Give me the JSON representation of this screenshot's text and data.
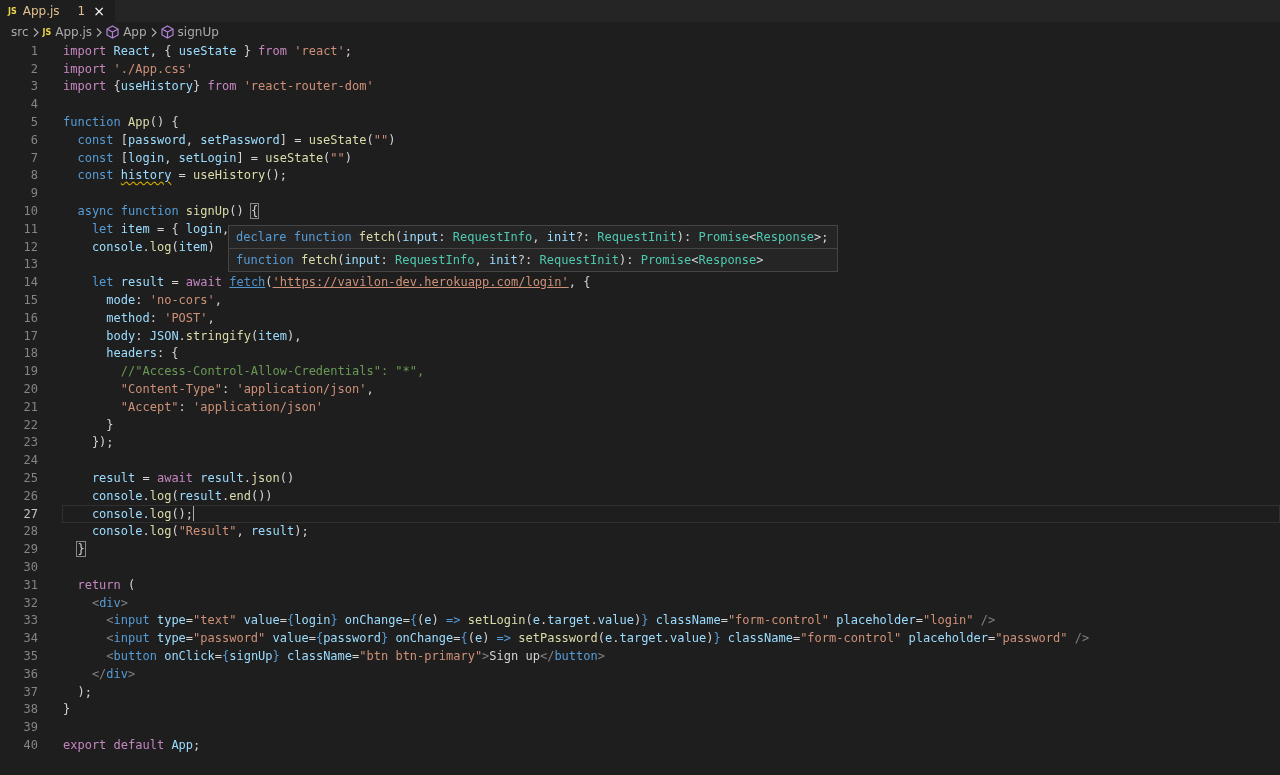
{
  "tab": {
    "file_type": "JS",
    "label": "App.js",
    "problems": "1",
    "close": "×",
    "selected": true
  },
  "breadcrumb": [
    {
      "kind": "folder",
      "label": "src"
    },
    {
      "kind": "file",
      "file_type": "JS",
      "label": "App.js"
    },
    {
      "kind": "symbol",
      "label": "App"
    },
    {
      "kind": "symbol",
      "label": "signUp"
    }
  ],
  "lines": [
    {
      "number": "1",
      "active": false,
      "tokens": [
        {
          "kind": "kw",
          "text": "import"
        },
        {
          "kind": "var",
          "text": " React"
        },
        {
          "kind": "plain",
          "text": ", { "
        },
        {
          "kind": "var",
          "text": "useState"
        },
        {
          "kind": "plain",
          "text": " } "
        },
        {
          "kind": "kw",
          "text": "from"
        },
        {
          "kind": "str",
          "text": " 'react'"
        },
        {
          "kind": "plain",
          "text": ";"
        }
      ]
    },
    {
      "number": "2",
      "active": false,
      "tokens": [
        {
          "kind": "kw",
          "text": "import"
        },
        {
          "kind": "str",
          "text": " './App.css'"
        }
      ]
    },
    {
      "number": "3",
      "active": false,
      "tokens": [
        {
          "kind": "kw",
          "text": "import"
        },
        {
          "kind": "plain",
          "text": " {"
        },
        {
          "kind": "var",
          "text": "useHistory"
        },
        {
          "kind": "plain",
          "text": "} "
        },
        {
          "kind": "kw",
          "text": "from"
        },
        {
          "kind": "str",
          "text": " 'react-router-dom'"
        }
      ]
    },
    {
      "number": "4",
      "active": false
    },
    {
      "number": "5",
      "active": false,
      "tokens": [
        {
          "kind": "decl",
          "text": "function"
        },
        {
          "kind": "fn",
          "text": " App"
        },
        {
          "kind": "plain",
          "text": "() {"
        }
      ]
    },
    {
      "number": "6",
      "active": false,
      "tokens": [
        {
          "kind": "decl",
          "text": "  const"
        },
        {
          "kind": "plain",
          "text": " ["
        },
        {
          "kind": "var",
          "text": "password"
        },
        {
          "kind": "plain",
          "text": ", "
        },
        {
          "kind": "var",
          "text": "setPassword"
        },
        {
          "kind": "plain",
          "text": "] = "
        },
        {
          "kind": "fn",
          "text": "useState"
        },
        {
          "kind": "plain",
          "text": "("
        },
        {
          "kind": "str",
          "text": "\"\""
        },
        {
          "kind": "plain",
          "text": ")"
        }
      ]
    },
    {
      "number": "7",
      "active": false,
      "tokens": [
        {
          "kind": "decl",
          "text": "  const"
        },
        {
          "kind": "plain",
          "text": " ["
        },
        {
          "kind": "var",
          "text": "login"
        },
        {
          "kind": "plain",
          "text": ", "
        },
        {
          "kind": "var",
          "text": "setLogin"
        },
        {
          "kind": "plain",
          "text": "] = "
        },
        {
          "kind": "fn",
          "text": "useState"
        },
        {
          "kind": "plain",
          "text": "("
        },
        {
          "kind": "str",
          "text": "\"\""
        },
        {
          "kind": "plain",
          "text": ")"
        }
      ]
    },
    {
      "number": "8",
      "active": false,
      "tokens": [
        {
          "kind": "decl",
          "text": "  const "
        },
        {
          "kind": "warn",
          "text": "history"
        },
        {
          "kind": "plain",
          "text": " = "
        },
        {
          "kind": "fn",
          "text": "useHistory"
        },
        {
          "kind": "plain",
          "text": "();"
        }
      ]
    },
    {
      "number": "9",
      "active": false
    },
    {
      "number": "10",
      "active": false,
      "tokens": [
        {
          "kind": "decl",
          "text": "  async"
        },
        {
          "kind": "decl",
          "text": " function"
        },
        {
          "kind": "fn",
          "text": " signUp"
        },
        {
          "kind": "plain",
          "text": "() "
        },
        {
          "kind": "match",
          "text": "{"
        }
      ]
    },
    {
      "number": "11",
      "active": false,
      "tokens": [
        {
          "kind": "decl",
          "text": "    let"
        },
        {
          "kind": "var",
          "text": " item"
        },
        {
          "kind": "plain",
          "text": " = { "
        },
        {
          "kind": "var",
          "text": "login"
        },
        {
          "kind": "plain",
          "text": ","
        }
      ]
    },
    {
      "number": "12",
      "active": false,
      "tokens": [
        {
          "kind": "var",
          "text": "    console"
        },
        {
          "kind": "plain",
          "text": "."
        },
        {
          "kind": "fn",
          "text": "log"
        },
        {
          "kind": "plain",
          "text": "("
        },
        {
          "kind": "var",
          "text": "item"
        },
        {
          "kind": "plain",
          "text": ")"
        }
      ]
    },
    {
      "number": "13",
      "active": false
    },
    {
      "number": "14",
      "active": false,
      "tokens": [
        {
          "kind": "decl",
          "text": "    let"
        },
        {
          "kind": "var",
          "text": " result"
        },
        {
          "kind": "plain",
          "text": " = "
        },
        {
          "kind": "kw",
          "text": "await "
        },
        {
          "kind": "hover",
          "text": "fetch"
        },
        {
          "kind": "plain",
          "text": "("
        },
        {
          "kind": "url",
          "text": "'https://vavilon-dev.herokuapp.com/login'"
        },
        {
          "kind": "plain",
          "text": ", {"
        }
      ]
    },
    {
      "number": "15",
      "active": false,
      "tokens": [
        {
          "kind": "var",
          "text": "      mode"
        },
        {
          "kind": "plain",
          "text": ": "
        },
        {
          "kind": "str",
          "text": "'no-cors'"
        },
        {
          "kind": "plain",
          "text": ","
        }
      ]
    },
    {
      "number": "16",
      "active": false,
      "tokens": [
        {
          "kind": "var",
          "text": "      method"
        },
        {
          "kind": "plain",
          "text": ": "
        },
        {
          "kind": "str",
          "text": "'POST'"
        },
        {
          "kind": "plain",
          "text": ","
        }
      ]
    },
    {
      "number": "17",
      "active": false,
      "tokens": [
        {
          "kind": "var",
          "text": "      body"
        },
        {
          "kind": "plain",
          "text": ": "
        },
        {
          "kind": "var",
          "text": "JSON"
        },
        {
          "kind": "plain",
          "text": "."
        },
        {
          "kind": "fn",
          "text": "stringify"
        },
        {
          "kind": "plain",
          "text": "("
        },
        {
          "kind": "var",
          "text": "item"
        },
        {
          "kind": "plain",
          "text": "),"
        }
      ]
    },
    {
      "number": "18",
      "active": false,
      "tokens": [
        {
          "kind": "var",
          "text": "      headers"
        },
        {
          "kind": "plain",
          "text": ": {"
        }
      ]
    },
    {
      "number": "19",
      "active": false,
      "tokens": [
        {
          "kind": "comment",
          "text": "        //\"Access-Control-Allow-Credentials\": \"*\","
        }
      ]
    },
    {
      "number": "20",
      "active": false,
      "tokens": [
        {
          "kind": "str",
          "text": "        \"Content-Type\""
        },
        {
          "kind": "plain",
          "text": ": "
        },
        {
          "kind": "str",
          "text": "'application/json'"
        },
        {
          "kind": "plain",
          "text": ","
        }
      ]
    },
    {
      "number": "21",
      "active": false,
      "tokens": [
        {
          "kind": "str",
          "text": "        \"Accept\""
        },
        {
          "kind": "plain",
          "text": ": "
        },
        {
          "kind": "str",
          "text": "'application/json'"
        }
      ]
    },
    {
      "number": "22",
      "active": false,
      "tokens": [
        {
          "kind": "plain",
          "text": "      }"
        }
      ]
    },
    {
      "number": "23",
      "active": false,
      "tokens": [
        {
          "kind": "plain",
          "text": "    });"
        }
      ]
    },
    {
      "number": "24",
      "active": false
    },
    {
      "number": "25",
      "active": false,
      "tokens": [
        {
          "kind": "var",
          "text": "    result"
        },
        {
          "kind": "plain",
          "text": " = "
        },
        {
          "kind": "kw",
          "text": "await"
        },
        {
          "kind": "var",
          "text": " result"
        },
        {
          "kind": "plain",
          "text": "."
        },
        {
          "kind": "fn",
          "text": "json"
        },
        {
          "kind": "plain",
          "text": "()"
        }
      ]
    },
    {
      "number": "26",
      "active": false,
      "tokens": [
        {
          "kind": "var",
          "text": "    console"
        },
        {
          "kind": "plain",
          "text": "."
        },
        {
          "kind": "fn",
          "text": "log"
        },
        {
          "kind": "plain",
          "text": "("
        },
        {
          "kind": "var",
          "text": "result"
        },
        {
          "kind": "plain",
          "text": "."
        },
        {
          "kind": "fn",
          "text": "end"
        },
        {
          "kind": "plain",
          "text": "())"
        }
      ]
    },
    {
      "number": "27",
      "active": true,
      "tokens": [
        {
          "kind": "var",
          "text": "    console."
        },
        {
          "kind": "fn",
          "text": "log"
        },
        {
          "kind": "plain",
          "text": "();"
        }
      ]
    },
    {
      "number": "28",
      "active": false,
      "tokens": [
        {
          "kind": "var",
          "text": "    console"
        },
        {
          "kind": "plain",
          "text": "."
        },
        {
          "kind": "fn",
          "text": "log"
        },
        {
          "kind": "plain",
          "text": "("
        },
        {
          "kind": "str",
          "text": "\"Result\""
        },
        {
          "kind": "plain",
          "text": ", "
        },
        {
          "kind": "var",
          "text": "result"
        },
        {
          "kind": "plain",
          "text": ");"
        }
      ]
    },
    {
      "number": "29",
      "active": false,
      "tokens": [
        {
          "kind": "indented_match",
          "text": "}"
        }
      ]
    },
    {
      "number": "30",
      "active": false
    },
    {
      "number": "31",
      "active": false,
      "tokens": [
        {
          "kind": "kw",
          "text": "  return"
        },
        {
          "kind": "plain",
          "text": " ("
        }
      ]
    },
    {
      "number": "32",
      "active": false,
      "tokens": [
        {
          "kind": "tag",
          "text": "    <"
        },
        {
          "kind": "decl",
          "text": "div"
        },
        {
          "kind": "tag",
          "text": ">"
        }
      ]
    },
    {
      "number": "33",
      "active": false,
      "tokens": [
        {
          "kind": "tag",
          "text": "      <"
        },
        {
          "kind": "decl",
          "text": "input"
        },
        {
          "kind": "var",
          "text": " type"
        },
        {
          "kind": "plain",
          "text": "="
        },
        {
          "kind": "str",
          "text": "\"text\""
        },
        {
          "kind": "var",
          "text": " value"
        },
        {
          "kind": "plain",
          "text": "="
        },
        {
          "kind": "decl",
          "text": "{"
        },
        {
          "kind": "var",
          "text": "login"
        },
        {
          "kind": "decl",
          "text": "}"
        },
        {
          "kind": "var",
          "text": " onChange"
        },
        {
          "kind": "plain",
          "text": "="
        },
        {
          "kind": "decl",
          "text": "{"
        },
        {
          "kind": "plain",
          "text": "("
        },
        {
          "kind": "var",
          "text": "e"
        },
        {
          "kind": "plain",
          "text": ") "
        },
        {
          "kind": "decl",
          "text": "=>"
        },
        {
          "kind": "fn",
          "text": " setLogin"
        },
        {
          "kind": "plain",
          "text": "("
        },
        {
          "kind": "var",
          "text": "e"
        },
        {
          "kind": "plain",
          "text": "."
        },
        {
          "kind": "var",
          "text": "target"
        },
        {
          "kind": "plain",
          "text": "."
        },
        {
          "kind": "var",
          "text": "value"
        },
        {
          "kind": "plain",
          "text": ")"
        },
        {
          "kind": "decl",
          "text": "}"
        },
        {
          "kind": "var",
          "text": " className"
        },
        {
          "kind": "plain",
          "text": "="
        },
        {
          "kind": "str",
          "text": "\"form-control\""
        },
        {
          "kind": "var",
          "text": " placeholder"
        },
        {
          "kind": "plain",
          "text": "="
        },
        {
          "kind": "str",
          "text": "\"login\""
        },
        {
          "kind": "tag",
          "text": " />"
        }
      ]
    },
    {
      "number": "34",
      "active": false,
      "tokens": [
        {
          "kind": "tag",
          "text": "      <"
        },
        {
          "kind": "decl",
          "text": "input"
        },
        {
          "kind": "var",
          "text": " type"
        },
        {
          "kind": "plain",
          "text": "="
        },
        {
          "kind": "str",
          "text": "\"password\""
        },
        {
          "kind": "var",
          "text": " value"
        },
        {
          "kind": "plain",
          "text": "="
        },
        {
          "kind": "decl",
          "text": "{"
        },
        {
          "kind": "var",
          "text": "password"
        },
        {
          "kind": "decl",
          "text": "}"
        },
        {
          "kind": "var",
          "text": " onChange"
        },
        {
          "kind": "plain",
          "text": "="
        },
        {
          "kind": "decl",
          "text": "{"
        },
        {
          "kind": "plain",
          "text": "("
        },
        {
          "kind": "var",
          "text": "e"
        },
        {
          "kind": "plain",
          "text": ") "
        },
        {
          "kind": "decl",
          "text": "=>"
        },
        {
          "kind": "fn",
          "text": " setPassword"
        },
        {
          "kind": "plain",
          "text": "("
        },
        {
          "kind": "var",
          "text": "e"
        },
        {
          "kind": "plain",
          "text": "."
        },
        {
          "kind": "var",
          "text": "target"
        },
        {
          "kind": "plain",
          "text": "."
        },
        {
          "kind": "var",
          "text": "value"
        },
        {
          "kind": "plain",
          "text": ")"
        },
        {
          "kind": "decl",
          "text": "}"
        },
        {
          "kind": "var",
          "text": " className"
        },
        {
          "kind": "plain",
          "text": "="
        },
        {
          "kind": "str",
          "text": "\"form-control\""
        },
        {
          "kind": "var",
          "text": " placeholder"
        },
        {
          "kind": "plain",
          "text": "="
        },
        {
          "kind": "str",
          "text": "\"password\""
        },
        {
          "kind": "tag",
          "text": " />"
        }
      ]
    },
    {
      "number": "35",
      "active": false,
      "tokens": [
        {
          "kind": "tag",
          "text": "      <"
        },
        {
          "kind": "decl",
          "text": "button"
        },
        {
          "kind": "var",
          "text": " onClick"
        },
        {
          "kind": "plain",
          "text": "="
        },
        {
          "kind": "decl",
          "text": "{"
        },
        {
          "kind": "var",
          "text": "signUp"
        },
        {
          "kind": "decl",
          "text": "}"
        },
        {
          "kind": "var",
          "text": " className"
        },
        {
          "kind": "plain",
          "text": "="
        },
        {
          "kind": "str",
          "text": "\"btn btn-primary\""
        },
        {
          "kind": "tag",
          "text": ">"
        },
        {
          "kind": "plain",
          "text": "Sign up"
        },
        {
          "kind": "tag",
          "text": "</"
        },
        {
          "kind": "decl",
          "text": "button"
        },
        {
          "kind": "tag",
          "text": ">"
        }
      ]
    },
    {
      "number": "36",
      "active": false,
      "tokens": [
        {
          "kind": "tag",
          "text": "    </"
        },
        {
          "kind": "decl",
          "text": "div"
        },
        {
          "kind": "tag",
          "text": ">"
        }
      ]
    },
    {
      "number": "37",
      "active": false,
      "tokens": [
        {
          "kind": "plain",
          "text": "  );"
        }
      ]
    },
    {
      "number": "38",
      "active": false,
      "tokens": [
        {
          "kind": "plain",
          "text": "}"
        }
      ]
    },
    {
      "number": "39",
      "active": false
    },
    {
      "number": "40",
      "active": false,
      "tokens": [
        {
          "kind": "kw",
          "text": "export"
        },
        {
          "kind": "kw",
          "text": " default"
        },
        {
          "kind": "var",
          "text": " App"
        },
        {
          "kind": "plain",
          "text": ";"
        }
      ]
    }
  ],
  "hover_tooltip": [
    {
      "tokens": [
        {
          "kind": "decl",
          "text": "declare"
        },
        {
          "kind": "decl",
          "text": " function"
        },
        {
          "kind": "fn",
          "text": " fetch"
        },
        {
          "kind": "plain",
          "text": "("
        },
        {
          "kind": "var",
          "text": "input"
        },
        {
          "kind": "plain",
          "text": ": "
        },
        {
          "kind": "type",
          "text": "RequestInfo"
        },
        {
          "kind": "plain",
          "text": ", "
        },
        {
          "kind": "var",
          "text": "init"
        },
        {
          "kind": "plain",
          "text": "?: "
        },
        {
          "kind": "type",
          "text": "RequestInit"
        },
        {
          "kind": "plain",
          "text": "): "
        },
        {
          "kind": "type",
          "text": "Promise"
        },
        {
          "kind": "plain",
          "text": "<"
        },
        {
          "kind": "type",
          "text": "Response"
        },
        {
          "kind": "plain",
          "text": ">;"
        }
      ]
    },
    {
      "tokens": [
        {
          "kind": "decl",
          "text": "function"
        },
        {
          "kind": "fn",
          "text": " fetch"
        },
        {
          "kind": "plain",
          "text": "("
        },
        {
          "kind": "var",
          "text": "input"
        },
        {
          "kind": "plain",
          "text": ": "
        },
        {
          "kind": "type",
          "text": "RequestInfo"
        },
        {
          "kind": "plain",
          "text": ", "
        },
        {
          "kind": "var",
          "text": "init"
        },
        {
          "kind": "plain",
          "text": "?: "
        },
        {
          "kind": "type",
          "text": "RequestInit"
        },
        {
          "kind": "plain",
          "text": "): "
        },
        {
          "kind": "type",
          "text": "Promise"
        },
        {
          "kind": "plain",
          "text": "<"
        },
        {
          "kind": "type",
          "text": "Response"
        },
        {
          "kind": "plain",
          "text": ">"
        }
      ]
    }
  ]
}
